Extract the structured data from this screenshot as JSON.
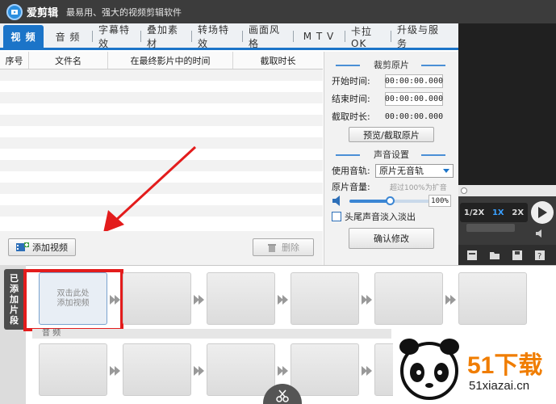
{
  "app": {
    "title": "爱剪辑",
    "slogan": "最易用、强大的视频剪辑软件"
  },
  "tabs": [
    {
      "label": "视 频",
      "active": true
    },
    {
      "label": "音 频"
    },
    {
      "label": "字幕特效"
    },
    {
      "label": "叠加素材"
    },
    {
      "label": "转场特效"
    },
    {
      "label": "画面风格"
    },
    {
      "label": "M T V"
    },
    {
      "label": "卡拉OK"
    },
    {
      "label": "升级与服务"
    }
  ],
  "table": {
    "headers": [
      "序号",
      "文件名",
      "在最终影片中的时间",
      "截取时长"
    ],
    "rows": []
  },
  "crop": {
    "title": "裁剪原片",
    "start_label": "开始时间:",
    "start_value": "00:00:00.000",
    "end_label": "结束时间:",
    "end_value": "00:00:00.000",
    "duration_label": "截取时长:",
    "duration_value": "00:00:00.000",
    "preview_button": "预览/截取原片"
  },
  "sound": {
    "title": "声音设置",
    "track_label": "使用音轨:",
    "track_value": "原片无音轨",
    "volume_label": "原片音量:",
    "volume_hint": "超过100%为扩音",
    "volume_value": "100%",
    "volume_level": 0.5,
    "fade_label": "头尾声音淡入淡出",
    "fade_checked": false,
    "confirm_button": "确认修改"
  },
  "actions": {
    "add_video": "添加视频",
    "delete": "删除"
  },
  "preview": {
    "speeds": [
      "1/2X",
      "1X",
      "2X"
    ],
    "active_speed": "1X"
  },
  "timeline": {
    "side_tab": [
      "已",
      "添",
      "加",
      "片",
      "段"
    ],
    "placeholder_line1": "双击此处",
    "placeholder_line2": "添加视频",
    "audio_label": "音 频"
  },
  "watermark": {
    "brand": "51下载",
    "url": "51xiazai.cn"
  },
  "colors": {
    "accent": "#1b74c8",
    "highlight": "#e31c1c",
    "brand_orange": "#f07d00"
  }
}
